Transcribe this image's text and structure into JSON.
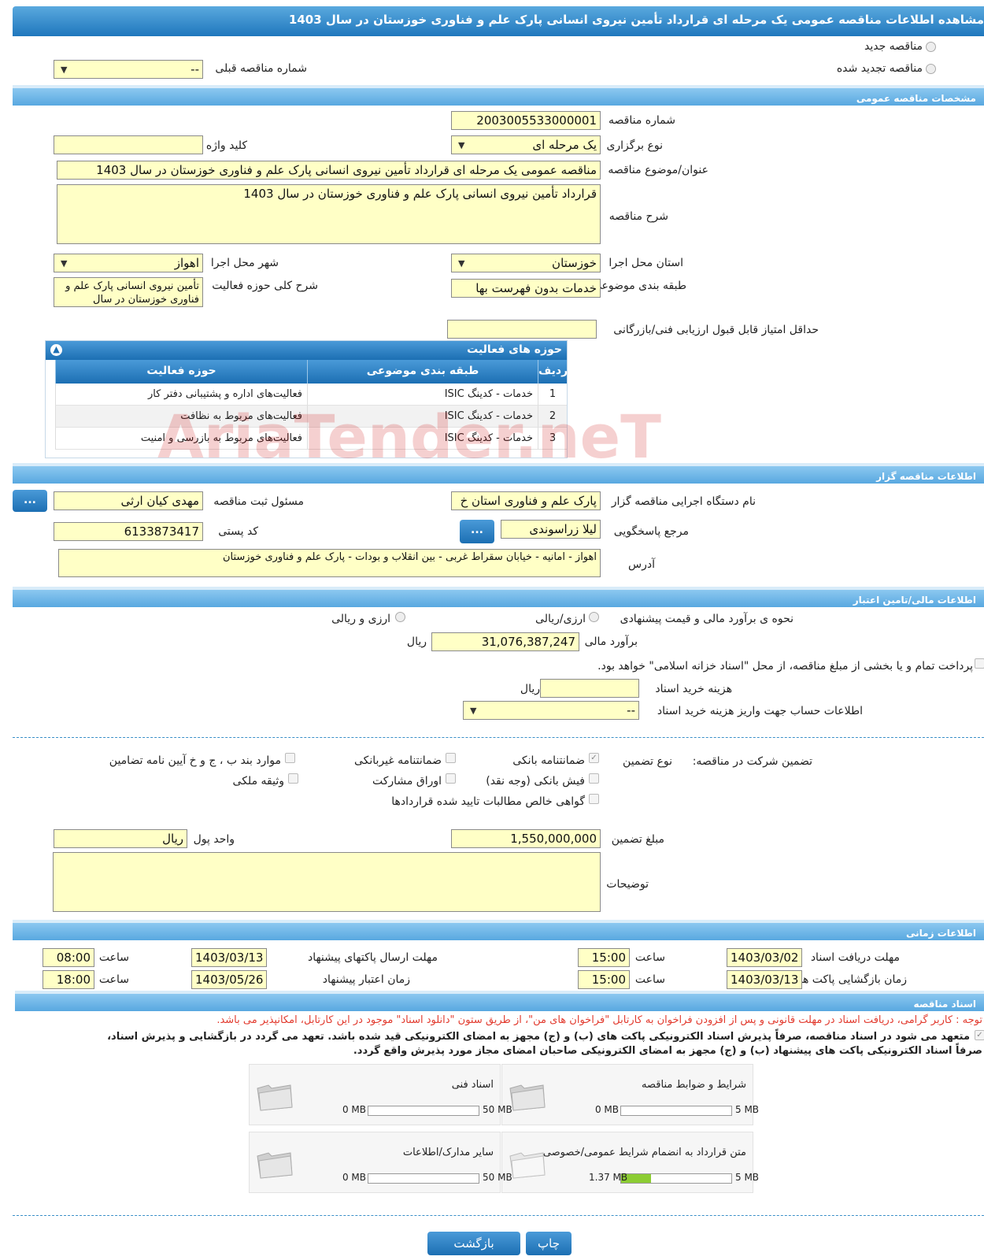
{
  "title": "مشاهده اطلاعات مناقصه عمومی یک مرحله ای قرارداد تأمین نیروی انسانی پارک علم و فناوری خوزستان در سال 1403",
  "tender_type": {
    "new_label": "مناقصه جدید",
    "renewed_label": "مناقصه تجدید شده",
    "previous_number_label": "شماره مناقصه قبلی",
    "previous_number_value": "--"
  },
  "general": {
    "section_title": "مشخصات مناقصه عمومی",
    "number_label": "شماره مناقصه",
    "number_value": "2003005533000001",
    "holding_type_label": "نوع برگزاری",
    "holding_type_value": "یک مرحله ای",
    "keyword_label": "کلید واژه",
    "keyword_value": "",
    "subject_label": "عنوان/موضوع مناقصه",
    "subject_value": "مناقصه عمومی یک مرحله ای قرارداد تأمین نیروی انسانی پارک علم و فناوری خوزستان در سال 1403",
    "description_label": "شرح مناقصه",
    "description_value": "قرارداد تأمین نیروی انسانی پارک علم و فناوری خوزستان در سال 1403",
    "province_label": "استان محل اجرا",
    "province_value": "خوزستان",
    "city_label": "شهر محل اجرا",
    "city_value": "اهواز",
    "category_label": "طبقه بندی موضوعی",
    "category_value": "خدمات بدون فهرست بها",
    "activity_desc_label": "شرح کلی حوزه فعالیت",
    "activity_desc_value": "تأمین نیروی انسانی پارک علم و فناوری خوزستان در سال",
    "min_score_label": "حداقل امتیاز قابل قبول ارزیابی فنی/بازرگانی",
    "min_score_value": ""
  },
  "activities": {
    "title": "حوزه های فعالیت",
    "headers": [
      "ردیف",
      "طبقه بندی موضوعی",
      "حوزه فعالیت"
    ],
    "rows": [
      {
        "n": "1",
        "cat": "خدمات - کدینگ ISIC",
        "area": "فعالیت‌های  اداره و پشتیبانی دفتر کار"
      },
      {
        "n": "2",
        "cat": "خدمات - کدینگ ISIC",
        "area": "فعالیت‌های مربوط به نظافت"
      },
      {
        "n": "3",
        "cat": "خدمات - کدینگ ISIC",
        "area": "فعالیت‌های مربوط به بازرسی و امنیت"
      }
    ]
  },
  "organizer": {
    "section_title": "اطلاعات مناقصه گزار",
    "org_label": "نام دستگاه اجرایی مناقصه گزار",
    "org_value": "پارک علم و فناوری استان خ",
    "registrar_label": "مسئول ثبت مناقصه",
    "registrar_value": "مهدی کیان ارثی",
    "contact_label": "مرجع پاسخگویی",
    "contact_value": "لیلا زراسوندی",
    "postal_label": "کد پستی",
    "postal_value": "6133873417",
    "address_label": "آدرس",
    "address_value": "اهواز - امانیه - خیابان سقراط غربی - بین انقلاب و بودات - پارک علم و فناوری خوزستان",
    "dots": "..."
  },
  "finance": {
    "section_title": "اطلاعات مالی/تامین اعتبار",
    "method_label": "نحوه ی برآورد مالی و قیمت پیشنهادی",
    "opt1": "ارزی/ریالی",
    "opt2": "ارزی و ریالی",
    "estimate_label": "برآورد مالی",
    "estimate_value": "31,076,387,247",
    "unit": "ریال",
    "treasury_text": "پرداخت تمام و یا بخشی از مبلغ مناقصه، از محل \"اسناد خزانه اسلامی\" خواهد بود.",
    "doc_fee_label": "هزینه خرید اسناد",
    "doc_fee_value": "",
    "account_label": "اطلاعات حساب جهت واریز هزینه خرید اسناد",
    "account_value": "--"
  },
  "guarantee": {
    "label": "تضمین شرکت در مناقصه:",
    "type_label": "نوع تضمین",
    "options": {
      "bank": "ضمانتنامه بانکی",
      "nonbank": "ضمانتنامه غیربانکی",
      "clauses": "موارد بند ب ، ج و خ آیین نامه تضامین",
      "cash": "فیش بانکی (وجه نقد)",
      "bonds": "اوراق مشارکت",
      "property": "وثیقه ملکی",
      "certificate": "گواهی خالص مطالبات تایید شده قراردادها"
    },
    "amount_label": "مبلغ تضمین",
    "amount_value": "1,550,000,000",
    "currency_label": "واحد پول",
    "currency_value": "ریال",
    "notes_label": "توضیحات",
    "notes_value": ""
  },
  "timing": {
    "section_title": "اطلاعات زمانی",
    "receive_label": "مهلت دریافت اسناد",
    "receive_date": "1403/03/02",
    "receive_time": "15:00",
    "send_label": "مهلت ارسال پاکتهای پیشنهاد",
    "send_date": "1403/03/13",
    "send_time": "08:00",
    "open_label": "زمان بازگشایی پاکت ها",
    "open_date": "1403/03/13",
    "open_time": "15:00",
    "validity_label": "زمان اعتبار پیشنهاد",
    "validity_date": "1403/05/26",
    "validity_time": "18:00",
    "time_label": "ساعت"
  },
  "documents": {
    "section_title": "اسناد مناقصه",
    "notice": "توجه : کاربر گرامی، دریافت اسناد در مهلت قانونی و پس از افزودن فراخوان به کارتابل \"فراخوان های من\"، از طریق ستون \"دانلود اسناد\" موجود در این کارتابل، امکانپذیر می باشد.",
    "commit_line1": "متعهد می شود در اسناد مناقصه، صرفاً پذیرش اسناد الکترونیکی پاکت های (ب) و (ج) مجهز به امضای الکترونیکی قید شده باشد. تعهد می گردد در بازگشایی و پذیرش اسناد،",
    "commit_line2": "صرفاً اسناد الکترونیکی پاکت های پیشنهاد (ب) و (ج) مجهز به امضای الکترونیکی صاحبان امضای مجاز مورد پذیرش واقع گردد.",
    "cards": [
      {
        "title": "شرایط و ضوابط مناقصه",
        "used": "0 MB",
        "max": "5 MB",
        "fill": 0
      },
      {
        "title": "اسناد فنی",
        "used": "0 MB",
        "max": "50 MB",
        "fill": 0
      },
      {
        "title": "متن قرارداد به انضمام شرایط عمومی/خصوصی",
        "used": "1.37 MB",
        "max": "5 MB",
        "fill": 0.27
      },
      {
        "title": "سایر مدارک/اطلاعات",
        "used": "0 MB",
        "max": "50 MB",
        "fill": 0
      }
    ]
  },
  "buttons": {
    "back": "بازگشت",
    "print": "چاپ"
  },
  "watermark": "AriaTender.neT"
}
